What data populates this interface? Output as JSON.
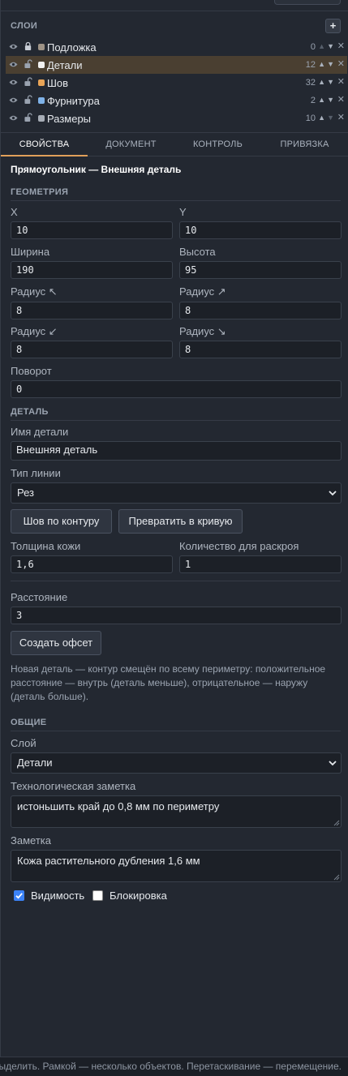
{
  "layers": {
    "title": "СЛОИ",
    "add_label": "+",
    "items": [
      {
        "name": "Подложка",
        "count": "0",
        "color": "#9e9386",
        "locked": true,
        "active": false,
        "up_dim": true,
        "down_dim": false
      },
      {
        "name": "Детали",
        "count": "12",
        "color": "#f1f1f1",
        "locked": false,
        "active": true,
        "up_dim": false,
        "down_dim": false
      },
      {
        "name": "Шов",
        "count": "32",
        "color": "#e8a457",
        "locked": false,
        "active": false,
        "up_dim": false,
        "down_dim": false
      },
      {
        "name": "Фурнитура",
        "count": "2",
        "color": "#7fb2e8",
        "locked": false,
        "active": false,
        "up_dim": false,
        "down_dim": false
      },
      {
        "name": "Размеры",
        "count": "10",
        "color": "#a7adb6",
        "locked": false,
        "active": false,
        "up_dim": false,
        "down_dim": true
      }
    ],
    "up_glyph": "▲",
    "down_glyph": "▼",
    "remove_glyph": "✕"
  },
  "tabs": [
    "СВОЙСТВА",
    "ДОКУМЕНТ",
    "КОНТРОЛЬ",
    "ПРИВЯЗКА"
  ],
  "active_tab": 0,
  "object_title": "Прямоугольник — Внешняя деталь",
  "geometry": {
    "title": "ГЕОМЕТРИЯ",
    "x_label": "X",
    "x_value": "10",
    "y_label": "Y",
    "y_value": "10",
    "width_label": "Ширина",
    "width_value": "190",
    "height_label": "Высота",
    "height_value": "95",
    "r1_label": "Радиус ↖",
    "r1_value": "8",
    "r2_label": "Радиус ↗",
    "r2_value": "8",
    "r3_label": "Радиус ↙",
    "r3_value": "8",
    "r4_label": "Радиус ↘",
    "r4_value": "8",
    "rotation_label": "Поворот",
    "rotation_value": "0"
  },
  "detail": {
    "title": "ДЕТАЛЬ",
    "name_label": "Имя детали",
    "name_value": "Внешняя деталь",
    "line_type_label": "Тип линии",
    "line_type_value": "Рез",
    "seam_button": "Шов по контуру",
    "to_curve_button": "Превратить в кривую",
    "thickness_label": "Толщина кожи",
    "thickness_value": "1,6",
    "qty_label": "Количество для раскроя",
    "qty_value": "1",
    "distance_label": "Расстояние",
    "distance_value": "3",
    "offset_button": "Создать офсет",
    "help": "Новая деталь — контур смещён по всему периметру: положительное расстояние — внутрь (деталь меньше), отрицательное — наружу (деталь больше)."
  },
  "general": {
    "title": "ОБЩИЕ",
    "layer_label": "Слой",
    "layer_value": "Детали",
    "tech_note_label": "Технологическая заметка",
    "tech_note_value": "истоньшить край до 0,8 мм по периметру",
    "note_label": "Заметка",
    "note_value": "Кожа растительного дубления 1,6 мм",
    "visibility_label": "Видимость",
    "visibility": true,
    "lock_label": "Блокировка",
    "lock": false
  },
  "status_bar": "ы выделить. Рамкой — несколько объектов. Перетаскивание — перемещение."
}
